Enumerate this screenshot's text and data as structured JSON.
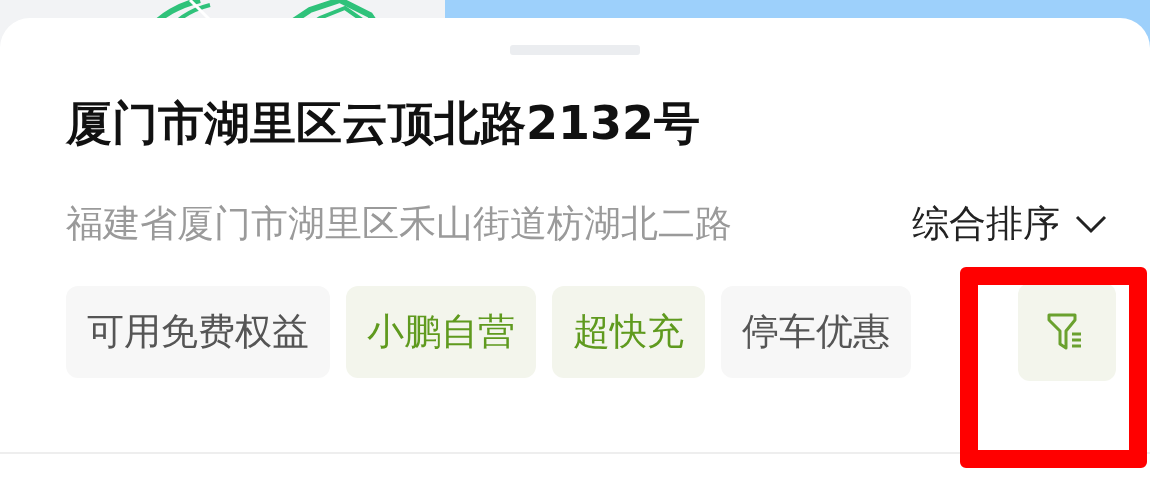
{
  "station": {
    "title": "厦门市湖里区云顶北路2132号",
    "address": "福建省厦门市湖里区禾山街道枋湖北二路"
  },
  "sort": {
    "label": "综合排序"
  },
  "chips": [
    {
      "label": "可用免费权益",
      "selected": false
    },
    {
      "label": "小鹏自营",
      "selected": true
    },
    {
      "label": "超快充",
      "selected": true
    },
    {
      "label": "停车优惠",
      "selected": false
    }
  ],
  "filter_button": {
    "highlighted": true
  }
}
